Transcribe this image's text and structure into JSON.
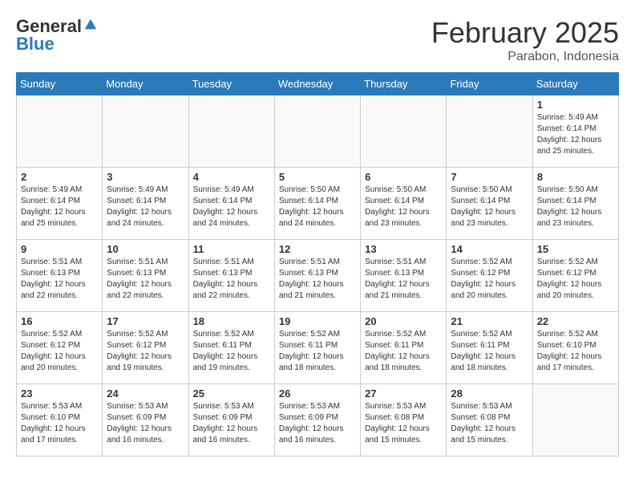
{
  "header": {
    "logo_general": "General",
    "logo_blue": "Blue",
    "title": "February 2025",
    "subtitle": "Parabon, Indonesia"
  },
  "weekdays": [
    "Sunday",
    "Monday",
    "Tuesday",
    "Wednesday",
    "Thursday",
    "Friday",
    "Saturday"
  ],
  "weeks": [
    [
      {
        "day": "",
        "info": ""
      },
      {
        "day": "",
        "info": ""
      },
      {
        "day": "",
        "info": ""
      },
      {
        "day": "",
        "info": ""
      },
      {
        "day": "",
        "info": ""
      },
      {
        "day": "",
        "info": ""
      },
      {
        "day": "1",
        "info": "Sunrise: 5:49 AM\nSunset: 6:14 PM\nDaylight: 12 hours and 25 minutes."
      }
    ],
    [
      {
        "day": "2",
        "info": "Sunrise: 5:49 AM\nSunset: 6:14 PM\nDaylight: 12 hours and 25 minutes."
      },
      {
        "day": "3",
        "info": "Sunrise: 5:49 AM\nSunset: 6:14 PM\nDaylight: 12 hours and 24 minutes."
      },
      {
        "day": "4",
        "info": "Sunrise: 5:49 AM\nSunset: 6:14 PM\nDaylight: 12 hours and 24 minutes."
      },
      {
        "day": "5",
        "info": "Sunrise: 5:50 AM\nSunset: 6:14 PM\nDaylight: 12 hours and 24 minutes."
      },
      {
        "day": "6",
        "info": "Sunrise: 5:50 AM\nSunset: 6:14 PM\nDaylight: 12 hours and 23 minutes."
      },
      {
        "day": "7",
        "info": "Sunrise: 5:50 AM\nSunset: 6:14 PM\nDaylight: 12 hours and 23 minutes."
      },
      {
        "day": "8",
        "info": "Sunrise: 5:50 AM\nSunset: 6:14 PM\nDaylight: 12 hours and 23 minutes."
      }
    ],
    [
      {
        "day": "9",
        "info": "Sunrise: 5:51 AM\nSunset: 6:13 PM\nDaylight: 12 hours and 22 minutes."
      },
      {
        "day": "10",
        "info": "Sunrise: 5:51 AM\nSunset: 6:13 PM\nDaylight: 12 hours and 22 minutes."
      },
      {
        "day": "11",
        "info": "Sunrise: 5:51 AM\nSunset: 6:13 PM\nDaylight: 12 hours and 22 minutes."
      },
      {
        "day": "12",
        "info": "Sunrise: 5:51 AM\nSunset: 6:13 PM\nDaylight: 12 hours and 21 minutes."
      },
      {
        "day": "13",
        "info": "Sunrise: 5:51 AM\nSunset: 6:13 PM\nDaylight: 12 hours and 21 minutes."
      },
      {
        "day": "14",
        "info": "Sunrise: 5:52 AM\nSunset: 6:12 PM\nDaylight: 12 hours and 20 minutes."
      },
      {
        "day": "15",
        "info": "Sunrise: 5:52 AM\nSunset: 6:12 PM\nDaylight: 12 hours and 20 minutes."
      }
    ],
    [
      {
        "day": "16",
        "info": "Sunrise: 5:52 AM\nSunset: 6:12 PM\nDaylight: 12 hours and 20 minutes."
      },
      {
        "day": "17",
        "info": "Sunrise: 5:52 AM\nSunset: 6:12 PM\nDaylight: 12 hours and 19 minutes."
      },
      {
        "day": "18",
        "info": "Sunrise: 5:52 AM\nSunset: 6:11 PM\nDaylight: 12 hours and 19 minutes."
      },
      {
        "day": "19",
        "info": "Sunrise: 5:52 AM\nSunset: 6:11 PM\nDaylight: 12 hours and 18 minutes."
      },
      {
        "day": "20",
        "info": "Sunrise: 5:52 AM\nSunset: 6:11 PM\nDaylight: 12 hours and 18 minutes."
      },
      {
        "day": "21",
        "info": "Sunrise: 5:52 AM\nSunset: 6:11 PM\nDaylight: 12 hours and 18 minutes."
      },
      {
        "day": "22",
        "info": "Sunrise: 5:52 AM\nSunset: 6:10 PM\nDaylight: 12 hours and 17 minutes."
      }
    ],
    [
      {
        "day": "23",
        "info": "Sunrise: 5:53 AM\nSunset: 6:10 PM\nDaylight: 12 hours and 17 minutes."
      },
      {
        "day": "24",
        "info": "Sunrise: 5:53 AM\nSunset: 6:09 PM\nDaylight: 12 hours and 16 minutes."
      },
      {
        "day": "25",
        "info": "Sunrise: 5:53 AM\nSunset: 6:09 PM\nDaylight: 12 hours and 16 minutes."
      },
      {
        "day": "26",
        "info": "Sunrise: 5:53 AM\nSunset: 6:09 PM\nDaylight: 12 hours and 16 minutes."
      },
      {
        "day": "27",
        "info": "Sunrise: 5:53 AM\nSunset: 6:08 PM\nDaylight: 12 hours and 15 minutes."
      },
      {
        "day": "28",
        "info": "Sunrise: 5:53 AM\nSunset: 6:08 PM\nDaylight: 12 hours and 15 minutes."
      },
      {
        "day": "",
        "info": ""
      }
    ]
  ]
}
